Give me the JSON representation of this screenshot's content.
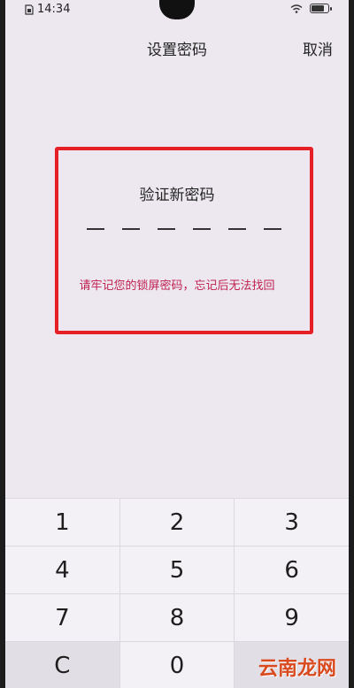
{
  "status": {
    "time": "14:34"
  },
  "header": {
    "title": "设置密码",
    "cancel_label": "取消"
  },
  "verify": {
    "title": "验证新密码",
    "warning": "请牢记您的锁屏密码，忘记后无法找回"
  },
  "keypad": {
    "row1": [
      "1",
      "2",
      "3"
    ],
    "row2": [
      "4",
      "5",
      "6"
    ],
    "row3": [
      "7",
      "8",
      "9"
    ],
    "row4": [
      "C",
      "0",
      ""
    ]
  },
  "watermark": "云南龙网",
  "colors": {
    "highlight": "#e61e25",
    "warning": "#c0204f"
  }
}
